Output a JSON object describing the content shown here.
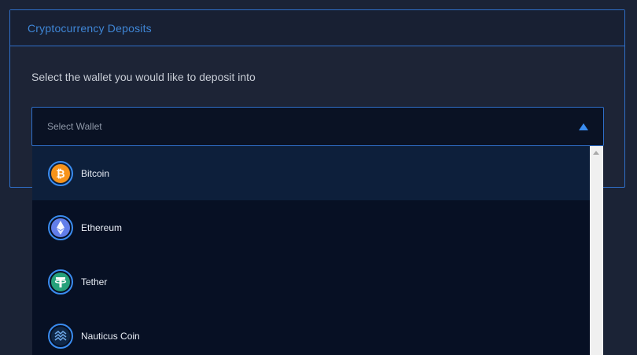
{
  "panel": {
    "title": "Cryptocurrency Deposits",
    "prompt": "Select the wallet you would like to deposit into"
  },
  "wallet_select": {
    "placeholder": "Select Wallet",
    "expanded": true
  },
  "wallet_options": [
    {
      "label": "Bitcoin",
      "icon": "bitcoin-icon",
      "color": "#f7931a"
    },
    {
      "label": "Ethereum",
      "icon": "ethereum-icon",
      "color": "#627eea"
    },
    {
      "label": "Tether",
      "icon": "tether-icon",
      "color": "#26a17b"
    },
    {
      "label": "Nauticus Coin",
      "icon": "nauticus-coin-icon",
      "color": "#0f2747"
    }
  ],
  "colors": {
    "accent": "#2f6fc9",
    "background": "#1b2336",
    "dropdown_background": "#071024",
    "highlight": "#0d1f3b"
  }
}
